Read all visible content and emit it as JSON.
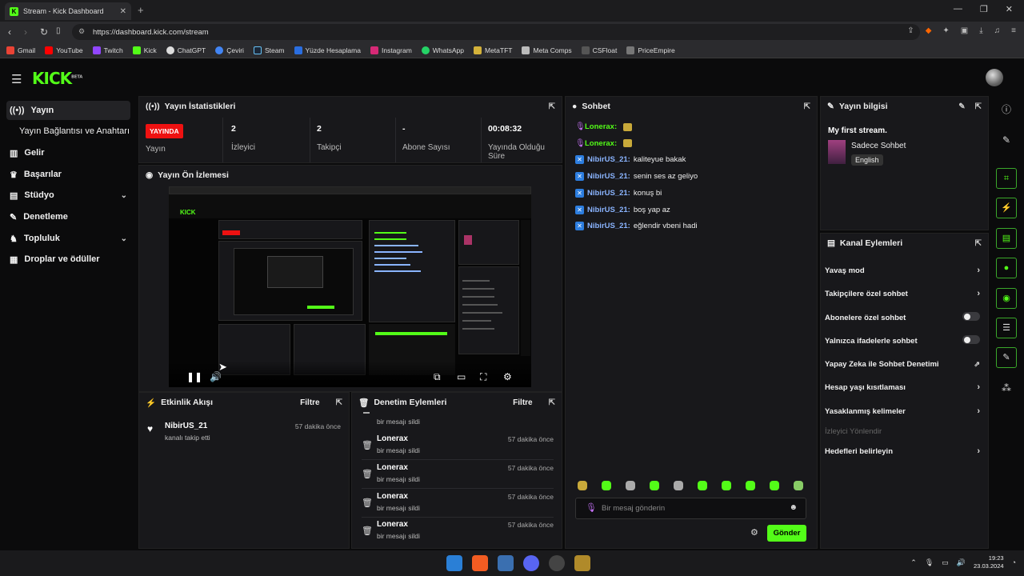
{
  "browser": {
    "tab_title": "Stream - Kick Dashboard",
    "url": "https://dashboard.kick.com/stream",
    "bookmarks": [
      "Gmail",
      "YouTube",
      "Twitch",
      "Kick",
      "ChatGPT",
      "Çeviri",
      "Steam",
      "Yüzde Hesaplama",
      "Instagram",
      "WhatsApp",
      "MetaTFT",
      "Meta Comps",
      "CSFloat",
      "PriceEmpire"
    ]
  },
  "brand": {
    "logo": "KICK",
    "logo_sup": "BETA",
    "accent": "#53fc18"
  },
  "sidebar": {
    "items": [
      {
        "label": "Yayın",
        "icon": "broadcast-icon"
      },
      {
        "label": "Yayın Bağlantısı ve Anahtarı"
      },
      {
        "label": "Gelir",
        "icon": "chart-icon"
      },
      {
        "label": "Başarılar",
        "icon": "trophy-icon"
      },
      {
        "label": "Stüdyo",
        "icon": "studio-icon"
      },
      {
        "label": "Denetleme",
        "icon": "wrench-icon"
      },
      {
        "label": "Topluluk",
        "icon": "community-icon"
      },
      {
        "label": "Droplar ve ödüller",
        "icon": "gift-icon"
      }
    ]
  },
  "stats": {
    "title": "Yayın İstatistikleri",
    "live_badge": "YAYINDA",
    "status_label": "Yayın",
    "viewers_value": "2",
    "viewers_label": "İzleyici",
    "followers_value": "2",
    "followers_label": "Takipçi",
    "subs_value": "-",
    "subs_label": "Abone Sayısı",
    "uptime_value": "00:08:32",
    "uptime_label": "Yayında Olduğu Süre"
  },
  "preview": {
    "title": "Yayın Ön İzlemesi"
  },
  "activity": {
    "title": "Etkinlik Akışı",
    "filter": "Filtre",
    "items": [
      {
        "user": "NibirUS_21",
        "action": "kanalı takip etti",
        "time": "57 dakika önce"
      }
    ]
  },
  "moderation": {
    "title": "Denetim Eylemleri",
    "filter": "Filtre",
    "partial_action": "bir mesajı sildi",
    "items": [
      {
        "user": "Lonerax",
        "action": "bir mesajı sildi",
        "time": "57 dakika önce"
      },
      {
        "user": "Lonerax",
        "action": "bir mesajı sildi",
        "time": "57 dakika önce"
      },
      {
        "user": "Lonerax",
        "action": "bir mesajı sildi",
        "time": "57 dakika önce"
      },
      {
        "user": "Lonerax",
        "action": "bir mesajı sildi",
        "time": "57 dakika önce"
      }
    ]
  },
  "chat": {
    "title": "Sohbet",
    "messages": [
      {
        "user": "Lonerax:",
        "text": "",
        "badge": "mic",
        "color": "#53fc18",
        "emote": true
      },
      {
        "user": "Lonerax:",
        "text": "",
        "badge": "mic",
        "color": "#53fc18",
        "emote": true
      },
      {
        "user": "NibirUS_21:",
        "text": "kaliteyue bakak",
        "badge": "kick",
        "color": "#8ab4ff"
      },
      {
        "user": "NibirUS_21:",
        "text": "senin ses az geliyo",
        "badge": "kick",
        "color": "#8ab4ff"
      },
      {
        "user": "NibirUS_21:",
        "text": "konuş bi",
        "badge": "kick",
        "color": "#8ab4ff"
      },
      {
        "user": "NibirUS_21:",
        "text": "boş yap az",
        "badge": "kick",
        "color": "#8ab4ff"
      },
      {
        "user": "NibirUS_21:",
        "text": "eğlendir vbeni hadi",
        "badge": "kick",
        "color": "#8ab4ff"
      }
    ],
    "input_placeholder": "Bir mesaj gönderin",
    "send_label": "Gönder"
  },
  "stream_info": {
    "title": "Yayın bilgisi",
    "stream_title": "My first stream.",
    "category": "Sadece Sohbet",
    "language": "English"
  },
  "channel_actions": {
    "title": "Kanal Eylemleri",
    "items": [
      {
        "label": "Yavaş mod",
        "control": "chevron"
      },
      {
        "label": "Takipçilere özel sohbet",
        "control": "chevron"
      },
      {
        "label": "Abonelere özel sohbet",
        "control": "toggle"
      },
      {
        "label": "Yalnızca ifadelerle sohbet",
        "control": "toggle"
      },
      {
        "label": "Yapay Zeka ile Sohbet Denetimi",
        "control": "external"
      },
      {
        "label": "Hesap yaşı kısıtlaması",
        "control": "chevron"
      },
      {
        "label": "Yasaklanmış kelimeler",
        "control": "chevron"
      },
      {
        "label": "İzleyici Yönlendir",
        "control": "disabled"
      },
      {
        "label": "Hedefleri belirleyin",
        "control": "chevron"
      }
    ]
  },
  "taskbar": {
    "time": "19:23",
    "date": "23.03.2024"
  }
}
